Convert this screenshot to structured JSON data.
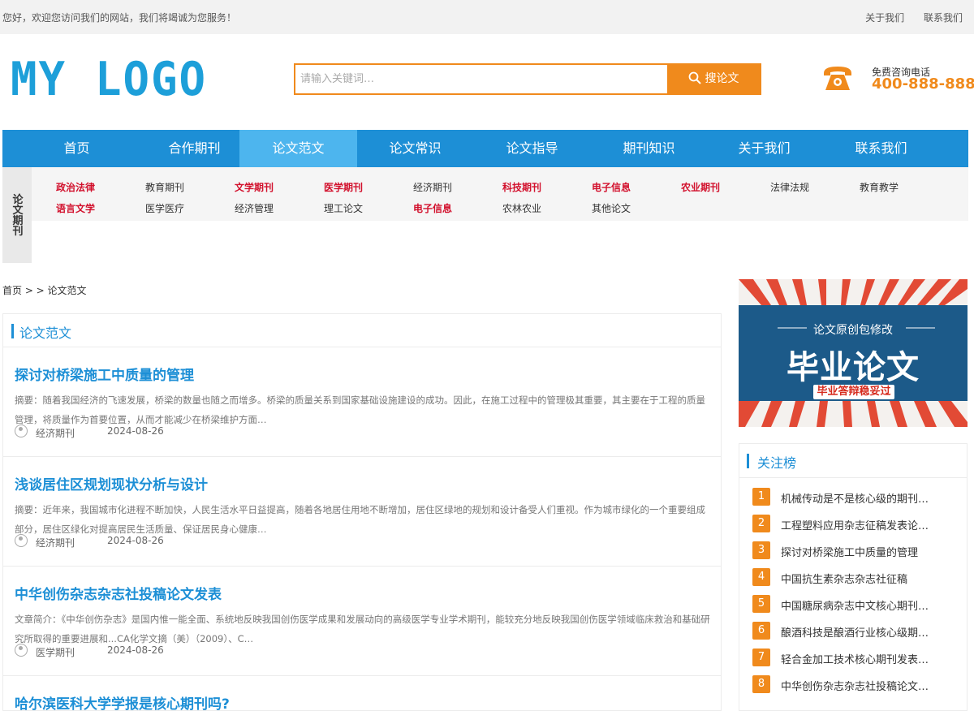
{
  "topbar": {
    "welcome": "您好，欢迎您访问我们的网站，我们将竭诚为您服务！",
    "links": [
      "关于我们",
      "联系我们"
    ]
  },
  "logo": {
    "word1": "MY",
    "word2": "LOGO"
  },
  "search": {
    "placeholder": "请输入关键词…",
    "button": "搜论文"
  },
  "phone": {
    "label": "免费咨询电话",
    "number": "400-888-8888"
  },
  "nav": [
    "首页",
    "合作期刊",
    "论文范文",
    "论文常识",
    "论文指导",
    "期刊知识",
    "关于我们",
    "联系我们"
  ],
  "nav_active": "论文范文",
  "categories": {
    "side_title": "论文期刊",
    "row1": [
      {
        "label": "政治法律",
        "hot": true
      },
      {
        "label": "教育期刊",
        "hot": false
      },
      {
        "label": "文学期刊",
        "hot": true
      },
      {
        "label": "医学期刊",
        "hot": true
      },
      {
        "label": "经济期刊",
        "hot": false
      },
      {
        "label": "科技期刊",
        "hot": true
      },
      {
        "label": "电子信息",
        "hot": true
      },
      {
        "label": "农业期刊",
        "hot": true
      },
      {
        "label": "法律法规",
        "hot": false
      },
      {
        "label": "教育教学",
        "hot": false
      }
    ],
    "row2": [
      {
        "label": "语言文学",
        "hot": true
      },
      {
        "label": "医学医疗",
        "hot": false
      },
      {
        "label": "经济管理",
        "hot": false
      },
      {
        "label": "理工论文",
        "hot": false
      },
      {
        "label": "电子信息",
        "hot": true
      },
      {
        "label": "农林农业",
        "hot": false
      },
      {
        "label": "其他论文",
        "hot": false
      }
    ]
  },
  "breadcrumb": "首页 > > 论文范文",
  "main": {
    "title": "论文范文",
    "articles": [
      {
        "title": "探讨对桥梁施工中质量的管理",
        "desc": "摘要：随着我国经济的飞速发展，桥梁的数量也随之而增多。桥梁的质量关系到国家基础设施建设的成功。因此，在施工过程中的管理极其重要，其主要在于工程的质量管理，将质量作为首要位置，从而才能减少在桥梁维护方面…",
        "category": "经济期刊",
        "date": "2024-08-26"
      },
      {
        "title": "浅谈居住区规划现状分析与设计",
        "desc": "摘要：近年来，我国城市化进程不断加快，人民生活水平日益提高，随着各地居住用地不断增加，居住区绿地的规划和设计备受人们重视。作为城市绿化的一个重要组成部分，居住区绿化对提高居民生活质量、保证居民身心健康…",
        "category": "经济期刊",
        "date": "2024-08-26"
      },
      {
        "title": "中华创伤杂志杂志社投稿论文发表",
        "desc": "文章简介：《中华创伤杂志》是国内惟一能全面、系统地反映我国创伤医学成果和发展动向的高级医学专业学术期刊，能较充分地反映我国创伤医学领域临床救治和基础研究所取得的重要进展和...CA化学文摘（美）（2009）、C…",
        "category": "医学期刊",
        "date": "2024-08-26"
      },
      {
        "title": "哈尔滨医科大学学报是核心期刊吗?",
        "desc": "",
        "category": "",
        "date": ""
      }
    ]
  },
  "banner": {
    "sub": "论文原创包修改",
    "big": "毕业论文",
    "pill": "毕业答辩稳妥过"
  },
  "rank": {
    "title": "关注榜",
    "items": [
      "机械传动是不是核心级的期刊…",
      "工程塑料应用杂志征稿发表论…",
      "探讨对桥梁施工中质量的管理",
      "中国抗生素杂志杂志社征稿",
      "中国糖尿病杂志中文核心期刊…",
      "酿酒科技是酿酒行业核心级期…",
      "轻合金加工技术核心期刊发表…",
      "中华创伤杂志杂志社投稿论文…"
    ]
  },
  "colors": {
    "brand_blue": "#1d8fd6",
    "accent_orange": "#f08a1c",
    "hot_red": "#d2102c"
  }
}
